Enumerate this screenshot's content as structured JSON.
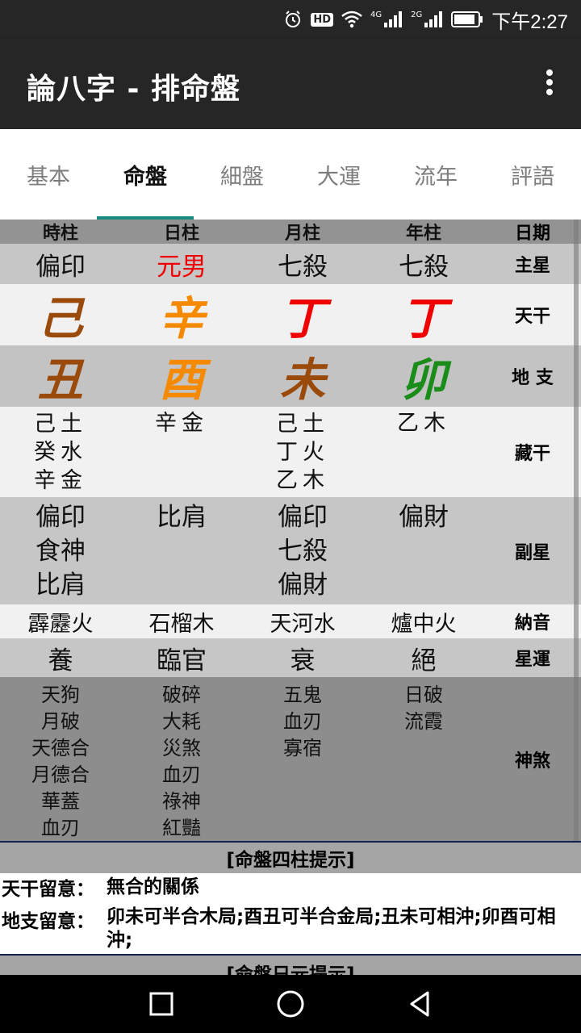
{
  "status": {
    "time": "下午2:27",
    "hd": "HD",
    "net1": "4G",
    "net2": "2G"
  },
  "appbar": {
    "title": "論八字 - 排命盤"
  },
  "tabs": [
    "基本",
    "命盤",
    "細盤",
    "大運",
    "流年",
    "評語"
  ],
  "active_tab": 1,
  "grid": {
    "headers": [
      "時柱",
      "日柱",
      "月柱",
      "年柱",
      "日期"
    ],
    "labels": {
      "main_star": "主星",
      "tiangan": "天干",
      "dizhi": "地 支",
      "canggan": "藏干",
      "fuxing": "副星",
      "nayin": "納音",
      "xingyun": "星運",
      "shensha": "神煞"
    },
    "main_star": [
      "偏印",
      "元男",
      "七殺",
      "七殺"
    ],
    "tiangan": [
      "己",
      "辛",
      "丁",
      "丁"
    ],
    "dizhi": [
      "丑",
      "酉",
      "未",
      "卯"
    ],
    "canggan": [
      [
        "己土",
        "癸水",
        "辛金"
      ],
      [
        "辛金"
      ],
      [
        "己土",
        "丁火",
        "乙木"
      ],
      [
        "乙木"
      ]
    ],
    "fuxing": [
      [
        "偏印",
        "食神",
        "比肩"
      ],
      [
        "比肩"
      ],
      [
        "偏印",
        "七殺",
        "偏財"
      ],
      [
        "偏財"
      ]
    ],
    "nayin": [
      "霹靂火",
      "石榴木",
      "天河水",
      "爐中火"
    ],
    "xingyun": [
      "養",
      "臨官",
      "衰",
      "絕"
    ],
    "shensha": [
      [
        "天狗",
        "月破",
        "天德合",
        "月德合",
        "華蓋",
        "血刃"
      ],
      [
        "破碎",
        "大耗",
        "災煞",
        "血刃",
        "祿神",
        "紅豔"
      ],
      [
        "五鬼",
        "血刃",
        "寡宿"
      ],
      [
        "日破",
        "流霞"
      ]
    ]
  },
  "colors": {
    "tiangan": [
      "#9a4a0b",
      "#f58a00",
      "#f00000",
      "#f00000"
    ],
    "dizhi": [
      "#9a4a0b",
      "#f58a00",
      "#9a4a0b",
      "#1a8c1a"
    ],
    "main_star": [
      "#111111",
      "#f00000",
      "#111111",
      "#111111"
    ],
    "accent_tab": "#1a8b7e"
  },
  "tips": {
    "title": "[命盤四柱提示]",
    "tiangan_key": "天干留意：",
    "tiangan_val": "無合的關係",
    "dizhi_key": "地支留意：",
    "dizhi_val": "卯未可半合木局;酉丑可半合金局;丑未可相沖;卯酉可相沖;",
    "title2": "[命盤日元提示]"
  }
}
